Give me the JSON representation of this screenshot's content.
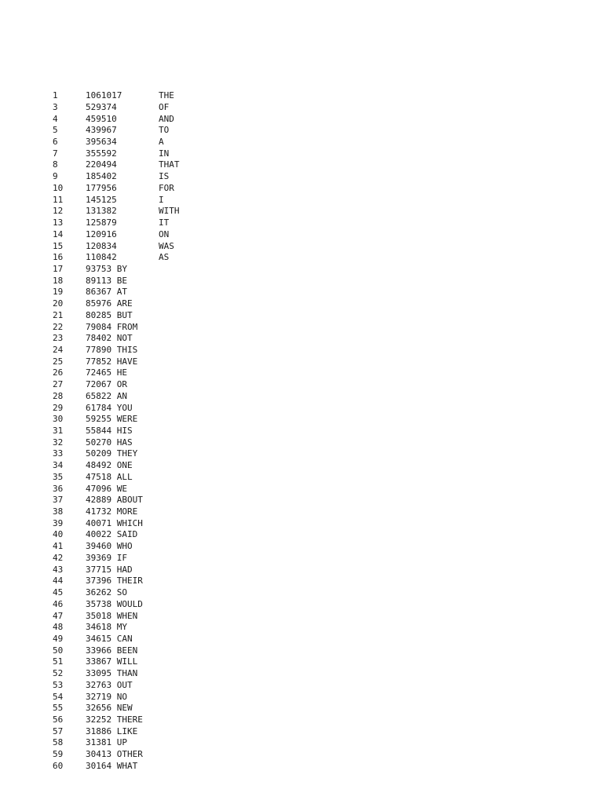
{
  "document": {
    "type": "plain-text-frequency-list",
    "background_color": "#ffffff",
    "text_color": "#1a1a1a",
    "columns": [
      "rank",
      "frequency",
      "word"
    ],
    "wide_row_count": 16,
    "note_missing_rank": 2
  },
  "rows": [
    {
      "rank": "1",
      "freq": "1061017",
      "word": "THE",
      "wide": true
    },
    {
      "rank": "3",
      "freq": "529374",
      "word": "OF",
      "wide": true
    },
    {
      "rank": "4",
      "freq": "459510",
      "word": "AND",
      "wide": true
    },
    {
      "rank": "5",
      "freq": "439967",
      "word": "TO",
      "wide": true
    },
    {
      "rank": "6",
      "freq": "395634",
      "word": "A",
      "wide": true
    },
    {
      "rank": "7",
      "freq": "355592",
      "word": "IN",
      "wide": true
    },
    {
      "rank": "8",
      "freq": "220494",
      "word": "THAT",
      "wide": true
    },
    {
      "rank": "9",
      "freq": "185402",
      "word": "IS",
      "wide": true
    },
    {
      "rank": "10",
      "freq": "177956",
      "word": "FOR",
      "wide": true
    },
    {
      "rank": "11",
      "freq": "145125",
      "word": "I",
      "wide": true
    },
    {
      "rank": "12",
      "freq": "131382",
      "word": "WITH",
      "wide": true
    },
    {
      "rank": "13",
      "freq": "125879",
      "word": "IT",
      "wide": true
    },
    {
      "rank": "14",
      "freq": "120916",
      "word": "ON",
      "wide": true
    },
    {
      "rank": "15",
      "freq": "120834",
      "word": "WAS",
      "wide": true
    },
    {
      "rank": "16",
      "freq": "110842",
      "word": "AS",
      "wide": true
    },
    {
      "rank": "17",
      "freq": "93753",
      "word": "BY",
      "wide": false
    },
    {
      "rank": "18",
      "freq": "89113",
      "word": "BE",
      "wide": false
    },
    {
      "rank": "19",
      "freq": "86367",
      "word": "AT",
      "wide": false
    },
    {
      "rank": "20",
      "freq": "85976",
      "word": "ARE",
      "wide": false
    },
    {
      "rank": "21",
      "freq": "80285",
      "word": "BUT",
      "wide": false
    },
    {
      "rank": "22",
      "freq": "79084",
      "word": "FROM",
      "wide": false
    },
    {
      "rank": "23",
      "freq": "78402",
      "word": "NOT",
      "wide": false
    },
    {
      "rank": "24",
      "freq": "77890",
      "word": "THIS",
      "wide": false
    },
    {
      "rank": "25",
      "freq": "77852",
      "word": "HAVE",
      "wide": false
    },
    {
      "rank": "26",
      "freq": "72465",
      "word": "HE",
      "wide": false
    },
    {
      "rank": "27",
      "freq": "72067",
      "word": "OR",
      "wide": false
    },
    {
      "rank": "28",
      "freq": "65822",
      "word": "AN",
      "wide": false
    },
    {
      "rank": "29",
      "freq": "61784",
      "word": "YOU",
      "wide": false
    },
    {
      "rank": "30",
      "freq": "59255",
      "word": "WERE",
      "wide": false
    },
    {
      "rank": "31",
      "freq": "55844",
      "word": "HIS",
      "wide": false
    },
    {
      "rank": "32",
      "freq": "50270",
      "word": "HAS",
      "wide": false
    },
    {
      "rank": "33",
      "freq": "50209",
      "word": "THEY",
      "wide": false
    },
    {
      "rank": "34",
      "freq": "48492",
      "word": "ONE",
      "wide": false
    },
    {
      "rank": "35",
      "freq": "47518",
      "word": "ALL",
      "wide": false
    },
    {
      "rank": "36",
      "freq": "47096",
      "word": "WE",
      "wide": false
    },
    {
      "rank": "37",
      "freq": "42889",
      "word": "ABOUT",
      "wide": false
    },
    {
      "rank": "38",
      "freq": "41732",
      "word": "MORE",
      "wide": false
    },
    {
      "rank": "39",
      "freq": "40071",
      "word": "WHICH",
      "wide": false
    },
    {
      "rank": "40",
      "freq": "40022",
      "word": "SAID",
      "wide": false
    },
    {
      "rank": "41",
      "freq": "39460",
      "word": "WHO",
      "wide": false
    },
    {
      "rank": "42",
      "freq": "39369",
      "word": "IF",
      "wide": false
    },
    {
      "rank": "43",
      "freq": "37715",
      "word": "HAD",
      "wide": false
    },
    {
      "rank": "44",
      "freq": "37396",
      "word": "THEIR",
      "wide": false
    },
    {
      "rank": "45",
      "freq": "36262",
      "word": "SO",
      "wide": false
    },
    {
      "rank": "46",
      "freq": "35738",
      "word": "WOULD",
      "wide": false
    },
    {
      "rank": "47",
      "freq": "35018",
      "word": "WHEN",
      "wide": false
    },
    {
      "rank": "48",
      "freq": "34618",
      "word": "MY",
      "wide": false
    },
    {
      "rank": "49",
      "freq": "34615",
      "word": "CAN",
      "wide": false
    },
    {
      "rank": "50",
      "freq": "33966",
      "word": "BEEN",
      "wide": false
    },
    {
      "rank": "51",
      "freq": "33867",
      "word": "WILL",
      "wide": false
    },
    {
      "rank": "52",
      "freq": "33095",
      "word": "THAN",
      "wide": false
    },
    {
      "rank": "53",
      "freq": "32763",
      "word": "OUT",
      "wide": false
    },
    {
      "rank": "54",
      "freq": "32719",
      "word": "NO",
      "wide": false
    },
    {
      "rank": "55",
      "freq": "32656",
      "word": "NEW",
      "wide": false
    },
    {
      "rank": "56",
      "freq": "32252",
      "word": "THERE",
      "wide": false
    },
    {
      "rank": "57",
      "freq": "31886",
      "word": "LIKE",
      "wide": false
    },
    {
      "rank": "58",
      "freq": "31381",
      "word": "UP",
      "wide": false
    },
    {
      "rank": "59",
      "freq": "30413",
      "word": "OTHER",
      "wide": false
    },
    {
      "rank": "60",
      "freq": "30164",
      "word": "WHAT",
      "wide": false
    }
  ]
}
